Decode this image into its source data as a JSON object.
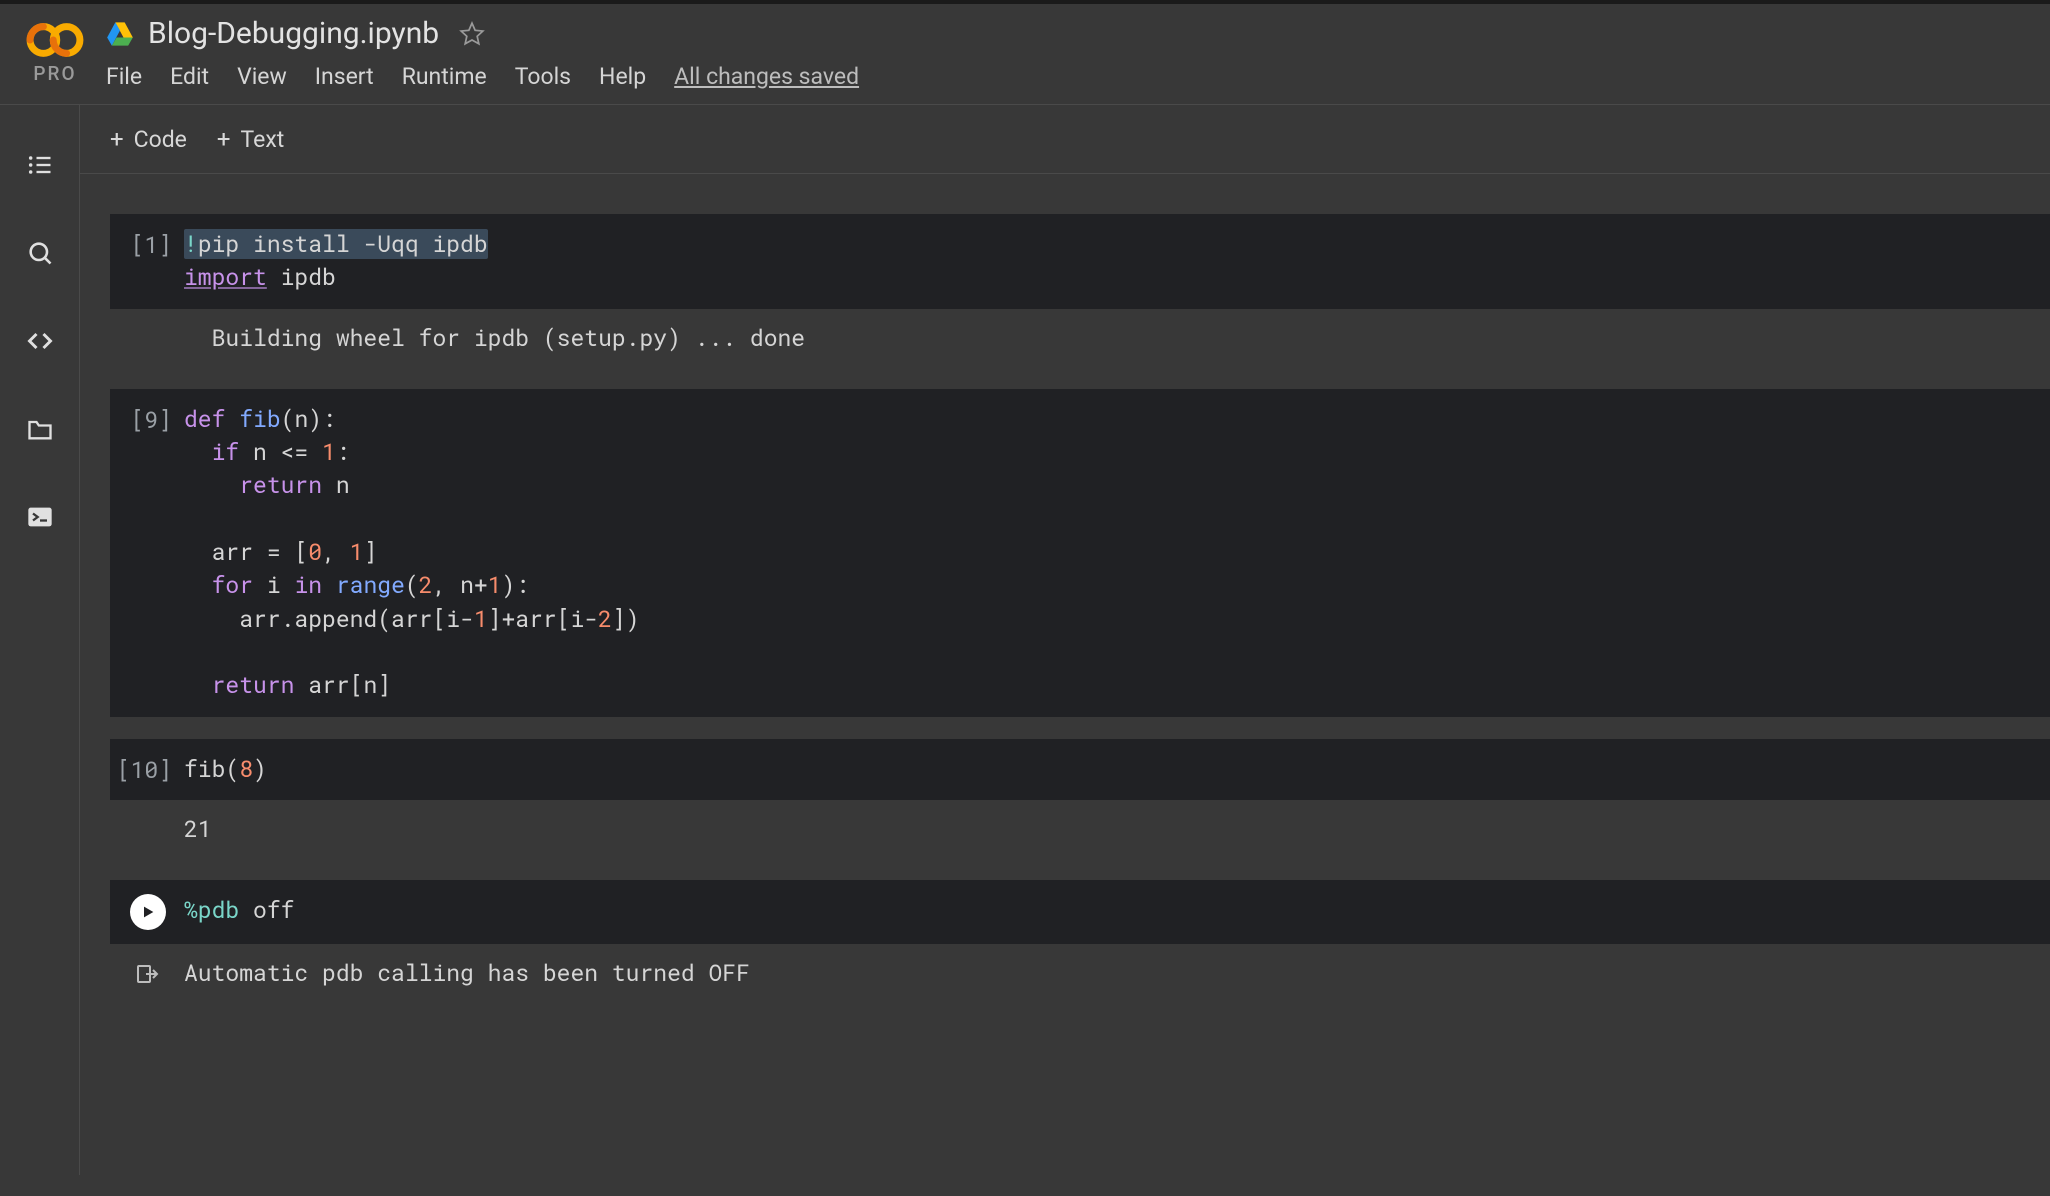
{
  "header": {
    "pro_label": "PRO",
    "file_title": "Blog-Debugging.ipynb",
    "save_status": "All changes saved",
    "menu": {
      "file": "File",
      "edit": "Edit",
      "view": "View",
      "insert": "Insert",
      "runtime": "Runtime",
      "tools": "Tools",
      "help": "Help"
    }
  },
  "toolbar": {
    "code_label": "Code",
    "text_label": "Text"
  },
  "cells": [
    {
      "exec_label": "[1]",
      "code": {
        "line1_cmd": "!",
        "line1_rest": "pip install -Uqq ipdb",
        "line2_import": "import",
        "line2_mod": " ipdb"
      },
      "output": "  Building wheel for ipdb (setup.py) ... done"
    },
    {
      "exec_label": "[9]",
      "code_raw": "def fib(n):\n  if n <= 1:\n    return n\n\n  arr = [0, 1]\n  for i in range(2, n+1):\n    arr.append(arr[i-1]+arr[i-2])\n\n  return arr[n]",
      "tokens": {
        "def": "def",
        "fib": " fib",
        "sig": "(n):",
        "if": "if",
        "cond": " n <= ",
        "one": "1",
        "colon1": ":",
        "return1": "return",
        "retn": " n",
        "arr_eq": "  arr = [",
        "zero": "0",
        "comma": ", ",
        "one2": "1",
        "close_br": "]",
        "for": "for",
        "forvar": " i ",
        "in": "in",
        "range": " range",
        "args": "(",
        "two": "2",
        "comma2": ", n+",
        "one3": "1",
        "close_p": "):",
        "append_line": "    arr.append(arr[i-",
        "one4": "1",
        "mid": "]+arr[i-",
        "two2": "2",
        "end_app": "])",
        "return2": "return",
        "retarr": " arr[n]"
      }
    },
    {
      "exec_label": "[10]",
      "code_plain": "fib(",
      "code_num": "8",
      "code_tail": ")",
      "output": "21"
    },
    {
      "exec_label": "",
      "magic": "%pdb",
      "magic_arg": " off",
      "output": "Automatic pdb calling has been turned OFF"
    }
  ]
}
